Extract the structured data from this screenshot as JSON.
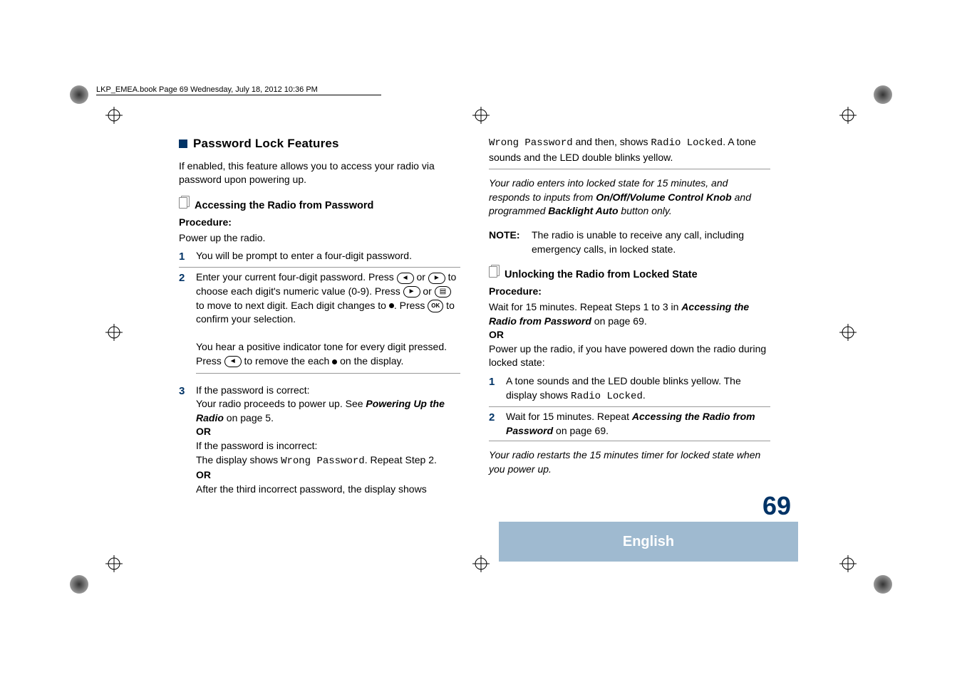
{
  "header": {
    "filebar": "LKP_EMEA.book  Page 69  Wednesday, July 18, 2012  10:36 PM"
  },
  "left": {
    "section_title": "Password Lock Features",
    "intro": "If enabled, this feature allows you to access your radio via password upon powering up.",
    "sub1_title": "Accessing the Radio from Password",
    "proc": "Procedure:",
    "powerup": "Power up the radio.",
    "s1": "You will be prompt to enter a four-digit password.",
    "s2a": "Enter your current four-digit password. Press ",
    "s2b": " or ",
    "s2c": " to choose each digit's numeric value (0-9). Press ",
    "s2d": " or ",
    "s2e": " to move to next digit. Each digit changes to ",
    "s2f": ". Press ",
    "s2g": " to confirm your selection.",
    "s2h": "You hear a positive indicator tone for every digit pressed. Press ",
    "s2i": " to remove the each ",
    "s2j": " on the display.",
    "s3a": "If the password is correct:",
    "s3b": "Your radio proceeds to power up. See ",
    "s3b_ref": "Powering Up the Radio",
    "s3b_end": " on page 5.",
    "or": "OR",
    "s3c": "If the password is incorrect:",
    "s3d": "The display shows ",
    "wrong_pw": "Wrong Password",
    "s3d_end": ". Repeat Step 2.",
    "s3e": "After the third incorrect password, the display shows "
  },
  "right": {
    "cont1a": " and then, shows ",
    "radio_locked": "Radio Locked",
    "cont1b": ". A tone sounds and the LED double blinks yellow.",
    "italics1a": "Your radio enters into locked state for 15 minutes, and responds to inputs from ",
    "knob": "On/Off/Volume Control Knob",
    "italics1b": " and programmed ",
    "backlight": "Backlight Auto",
    "italics1c": " button only.",
    "note_label": "NOTE:",
    "note_text": "The radio is unable to receive any call, including emergency calls, in locked state.",
    "sub2_title": "Unlocking the Radio from Locked State",
    "proc": "Procedure:",
    "wait_a": "Wait for 15 minutes. Repeat Steps 1 to 3 in ",
    "access_ref": "Accessing the Radio from Password",
    "wait_b": " on page 69.",
    "or": "OR",
    "powerup2": "Power up the radio, if you have powered down the radio during locked state:",
    "r1a": "A tone sounds and the LED double blinks yellow. The display shows ",
    "r1b": ".",
    "r2a": "Wait for 15 minutes. Repeat ",
    "r2b": " on page 69.",
    "italics2": "Your radio restarts the 15 minutes timer for locked state when you power up."
  },
  "footer": {
    "page": "69",
    "lang": "English"
  }
}
